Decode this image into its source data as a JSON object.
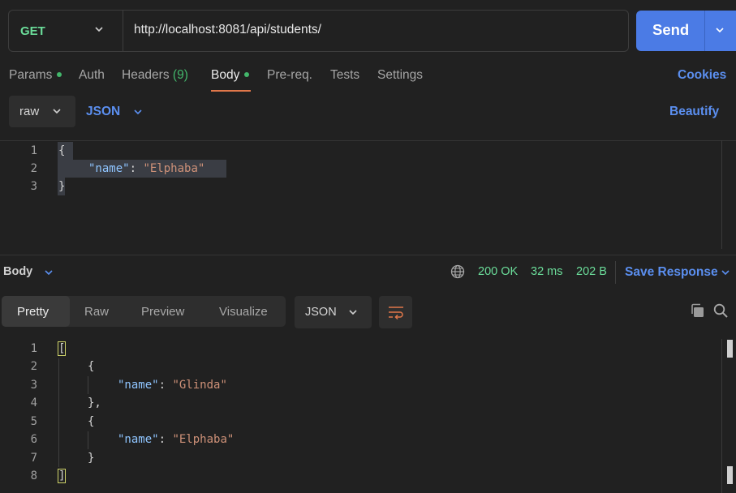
{
  "request": {
    "method": "GET",
    "url": "http://localhost:8081/api/students/",
    "send_label": "Send"
  },
  "tabs": [
    {
      "label": "Params",
      "dot": true
    },
    {
      "label": "Auth"
    },
    {
      "label": "Headers",
      "count": "(9)"
    },
    {
      "label": "Body",
      "dot": true,
      "active": true
    },
    {
      "label": "Pre-req."
    },
    {
      "label": "Tests"
    },
    {
      "label": "Settings"
    }
  ],
  "cookies_label": "Cookies",
  "body_mode": "raw",
  "body_format": "JSON",
  "beautify_label": "Beautify",
  "request_body": {
    "line_numbers": [
      "1",
      "2",
      "3"
    ],
    "lines": [
      "{",
      "\"name\"",
      ": ",
      "\"Elphaba\"",
      "}"
    ]
  },
  "response": {
    "section_label": "Body",
    "status": "200 OK",
    "time": "32 ms",
    "size": "202 B",
    "save_label": "Save Response",
    "view_tabs": [
      "Pretty",
      "Raw",
      "Preview",
      "Visualize"
    ],
    "active_view": "Pretty",
    "format": "JSON",
    "line_numbers": [
      "1",
      "2",
      "3",
      "4",
      "5",
      "6",
      "7",
      "8"
    ],
    "code": {
      "open_array": "[",
      "open_obj": "{",
      "key": "\"name\"",
      "colon": ": ",
      "value1": "\"Glinda\"",
      "close_obj_comma": "},",
      "value2": "\"Elphaba\"",
      "close_obj": "}",
      "close_array": "]"
    }
  },
  "colors": {
    "accent_blue": "#4b7be5",
    "link_blue": "#5b8ff0",
    "success_green": "#6bdd9a",
    "tab_underline": "#e0774a",
    "string": "#ce9178",
    "key": "#8fc5ff"
  },
  "icons": [
    "chevron-down-icon",
    "globe-icon",
    "wrap-lines-icon",
    "copy-icon",
    "search-icon"
  ]
}
